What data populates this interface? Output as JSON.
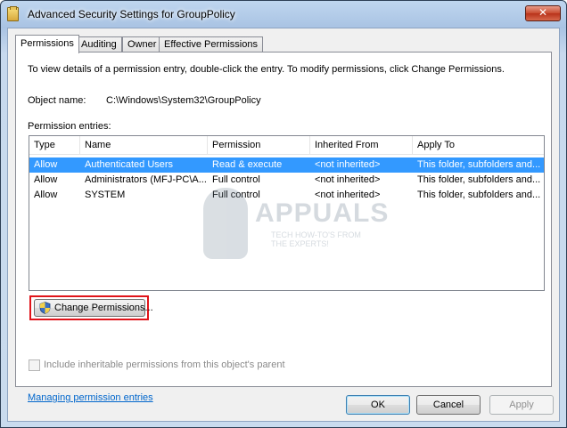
{
  "window": {
    "title": "Advanced Security Settings for GroupPolicy",
    "close_glyph": "✕"
  },
  "tabs": [
    {
      "label": "Permissions",
      "active": true
    },
    {
      "label": "Auditing",
      "active": false
    },
    {
      "label": "Owner",
      "active": false
    },
    {
      "label": "Effective Permissions",
      "active": false
    }
  ],
  "panel": {
    "description": "To view details of a permission entry, double-click the entry. To modify permissions, click Change Permissions.",
    "object_name_label": "Object name:",
    "object_name_value": "C:\\Windows\\System32\\GroupPolicy",
    "entries_label": "Permission entries:"
  },
  "table": {
    "columns": [
      "Type",
      "Name",
      "Permission",
      "Inherited From",
      "Apply To"
    ],
    "rows": [
      {
        "type": "Allow",
        "name": "Authenticated Users",
        "permission": "Read & execute",
        "inherited": "<not inherited>",
        "apply_to": "This folder, subfolders and...",
        "selected": true
      },
      {
        "type": "Allow",
        "name": "Administrators (MFJ-PC\\A...",
        "permission": "Full control",
        "inherited": "<not inherited>",
        "apply_to": "This folder, subfolders and...",
        "selected": false
      },
      {
        "type": "Allow",
        "name": "SYSTEM",
        "permission": "Full control",
        "inherited": "<not inherited>",
        "apply_to": "This folder, subfolders and...",
        "selected": false
      }
    ]
  },
  "watermark": {
    "brand": "APPUALS",
    "tagline": "TECH HOW-TO'S FROM THE EXPERTS!"
  },
  "change_permissions_label": "Change Permissions...",
  "inherit_checkbox": {
    "label": "Include inheritable permissions from this object's parent",
    "checked": false,
    "enabled": false
  },
  "help_link": "Managing permission entries",
  "buttons": {
    "ok": "OK",
    "cancel": "Cancel",
    "apply": "Apply"
  },
  "colors": {
    "selection": "#3399ff",
    "highlight_box": "#e0141a",
    "link": "#0066cc"
  },
  "icons": {
    "title": "folder-icon",
    "change_button": "uac-shield-icon"
  }
}
